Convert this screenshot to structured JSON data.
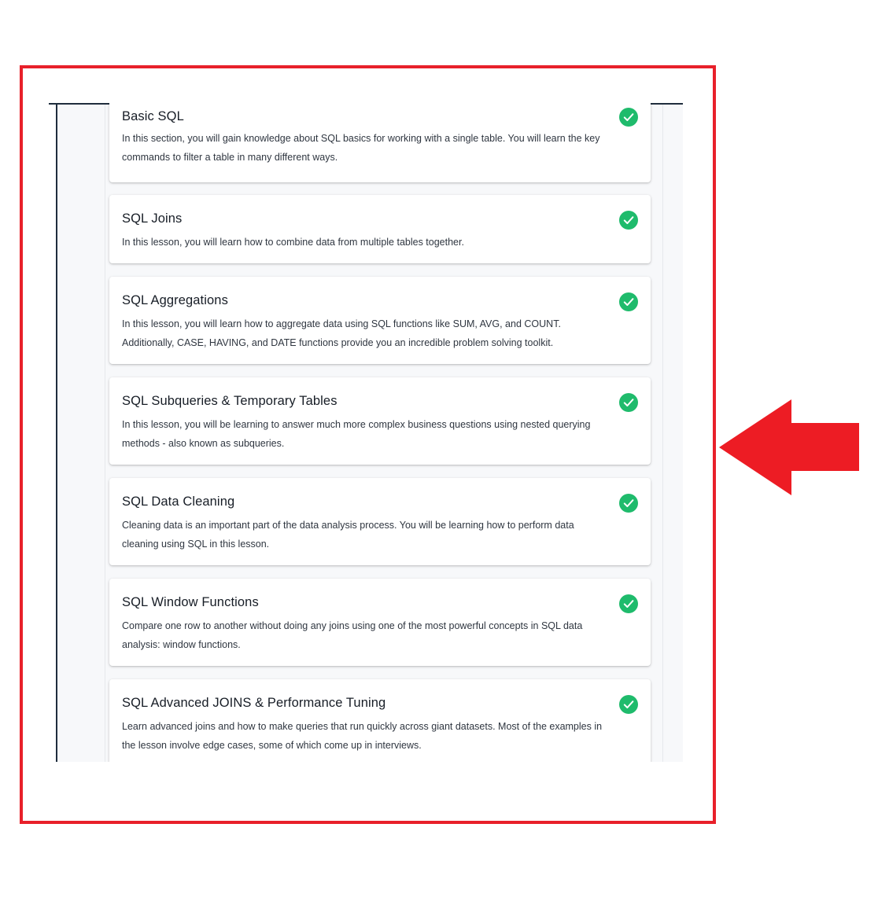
{
  "lessons": [
    {
      "title": "Basic SQL",
      "description": "In this section, you will gain knowledge about SQL basics for working with a single table. You will learn the key commands to filter a table in many different ways.",
      "completed": true
    },
    {
      "title": "SQL Joins",
      "description": "In this lesson, you will learn how to combine data from multiple tables together.",
      "completed": true
    },
    {
      "title": "SQL Aggregations",
      "description": "In this lesson, you will learn how to aggregate data using SQL functions like SUM, AVG, and COUNT. Additionally, CASE, HAVING, and DATE functions provide you an incredible problem solving toolkit.",
      "completed": true
    },
    {
      "title": "SQL Subqueries & Temporary Tables",
      "description": "In this lesson, you will be learning to answer much more complex business questions using nested querying methods - also known as subqueries.",
      "completed": true
    },
    {
      "title": "SQL Data Cleaning",
      "description": "Cleaning data is an important part of the data analysis process. You will be learning how to perform data cleaning using SQL in this lesson.",
      "completed": true
    },
    {
      "title": "SQL Window Functions",
      "description": "Compare one row to another without doing any joins using one of the most powerful concepts in SQL data analysis: window functions.",
      "completed": true
    },
    {
      "title": "SQL Advanced JOINS & Performance Tuning",
      "description": "Learn advanced joins and how to make queries that run quickly across giant datasets. Most of the examples in the lesson involve edge cases, some of which come up in interviews.",
      "completed": true
    }
  ],
  "colors": {
    "highlight": "#e8202a",
    "check": "#1fbb6c",
    "rule": "#1f2d3d"
  },
  "icons": {
    "completed": "check-circle-icon",
    "annotation": "arrow-left-icon"
  }
}
